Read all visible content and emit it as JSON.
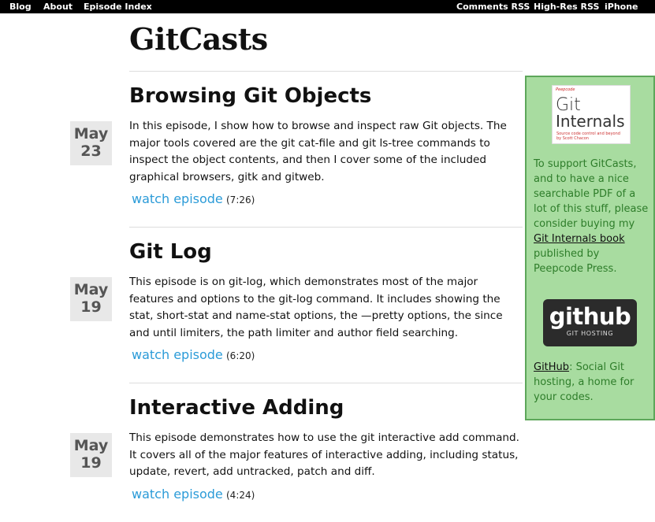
{
  "topbar": {
    "left_links": [
      "Blog",
      "About",
      "Episode Index"
    ],
    "right_links": [
      "Comments RSS",
      "High-Res RSS",
      "iPhone RSS"
    ]
  },
  "site": {
    "title": "GitCasts"
  },
  "episodes": [
    {
      "title": "Browsing Git Objects",
      "month": "May",
      "day": "23",
      "description": "In this episode, I show how to browse and inspect raw Git objects. The major tools covered are the git cat-file and git ls-tree commands to inspect the object contents, and then I cover some of the included graphical browsers, gitk and gitweb.",
      "watch_label": "watch episode",
      "duration": "(7:26)"
    },
    {
      "title": "Git Log",
      "month": "May",
      "day": "19",
      "description": "This episode is on git-log, which demonstrates most of the major features and options to the git-log command. It includes showing the stat, short-stat and name-stat options, the —pretty options, the since and until limiters, the path limiter and author field searching.",
      "watch_label": "watch episode",
      "duration": "(6:20)"
    },
    {
      "title": "Interactive Adding",
      "month": "May",
      "day": "19",
      "description": "This episode demonstrates how to use the git interactive add command. It covers all of the major features of interactive adding, including status, update, revert, add untracked, patch and diff.",
      "watch_label": "watch episode",
      "duration": "(4:24)"
    }
  ],
  "sidebar": {
    "book_cover": {
      "line1": "Git",
      "line2": "Internals",
      "subtitle": "Source code control and beyond",
      "author": "by Scott Chacon",
      "publisher_mark": "Peepcode"
    },
    "support_text_before": "To support GitCasts, and to have a nice searchable PDF of a lot of this stuff, please consider buying my ",
    "book_link": "Git Internals book",
    "support_text_after": " published by Peepcode Press.",
    "github_logo": {
      "big": "github",
      "small": "GIT HOSTING"
    },
    "github_link": "GitHub",
    "github_text": ": Social Git hosting, a home for your codes.",
    "colors": {
      "background": "#a8dca0",
      "border": "#5da75a",
      "text": "#2e7d2a"
    }
  },
  "colors": {
    "link": "#2b9bd8",
    "topbar": "#000000"
  }
}
